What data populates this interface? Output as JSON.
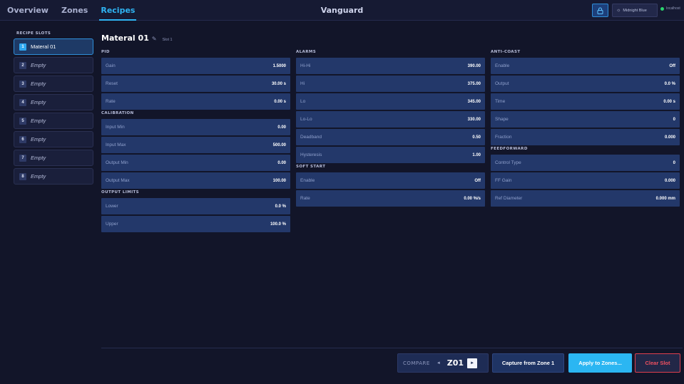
{
  "app": {
    "title": "Vanguard",
    "nav": [
      "Overview",
      "Zones",
      "Recipes"
    ],
    "active_nav": "Recipes",
    "theme_label": "Midnight Blue",
    "connection_label": "localhost"
  },
  "sidebar": {
    "heading": "RECIPE SLOTS",
    "slots": [
      {
        "num": "1",
        "name": "Materal 01",
        "active": true
      },
      {
        "num": "2",
        "name": "Empty"
      },
      {
        "num": "3",
        "name": "Empty"
      },
      {
        "num": "4",
        "name": "Empty"
      },
      {
        "num": "5",
        "name": "Empty"
      },
      {
        "num": "6",
        "name": "Empty"
      },
      {
        "num": "7",
        "name": "Empty"
      },
      {
        "num": "8",
        "name": "Empty"
      }
    ]
  },
  "recipe": {
    "name": "Materal 01",
    "slot_tag": "Slot 1"
  },
  "sections": {
    "pid": {
      "title": "PID",
      "rows": [
        {
          "label": "Gain",
          "value": "1.5000"
        },
        {
          "label": "Reset",
          "value": "30.00 s"
        },
        {
          "label": "Rate",
          "value": "0.00 s"
        }
      ]
    },
    "calibration": {
      "title": "CALIBRATION",
      "rows": [
        {
          "label": "Input Min",
          "value": "0.00"
        },
        {
          "label": "Input Max",
          "value": "500.00"
        },
        {
          "label": "Output Min",
          "value": "0.00"
        },
        {
          "label": "Output Max",
          "value": "100.00"
        }
      ]
    },
    "output_limits": {
      "title": "OUTPUT LIMITS",
      "rows": [
        {
          "label": "Lower",
          "value": "0.0 %"
        },
        {
          "label": "Upper",
          "value": "100.0 %"
        }
      ]
    },
    "alarms": {
      "title": "ALARMS",
      "rows": [
        {
          "label": "Hi-Hi",
          "value": "390.00"
        },
        {
          "label": "Hi",
          "value": "375.00"
        },
        {
          "label": "Lo",
          "value": "345.00"
        },
        {
          "label": "Lo-Lo",
          "value": "330.00"
        },
        {
          "label": "Deadband",
          "value": "0.50"
        },
        {
          "label": "Hysteresis",
          "value": "1.00"
        }
      ]
    },
    "soft_start": {
      "title": "SOFT START",
      "rows": [
        {
          "label": "Enable",
          "value": "Off"
        },
        {
          "label": "Rate",
          "value": "0.00 %/s"
        }
      ]
    },
    "anti_coast": {
      "title": "ANTI-COAST",
      "rows": [
        {
          "label": "Enable",
          "value": "Off"
        },
        {
          "label": "Output",
          "value": "0.0 %"
        },
        {
          "label": "Time",
          "value": "0.00 s"
        },
        {
          "label": "Shape",
          "value": "0"
        },
        {
          "label": "Fraction",
          "value": "0.000"
        }
      ]
    },
    "feedforward": {
      "title": "FEEDFORWARD",
      "rows": [
        {
          "label": "Control Type",
          "value": "0"
        },
        {
          "label": "FF Gain",
          "value": "0.000"
        },
        {
          "label": "Ref Diameter",
          "value": "0.000 mm"
        }
      ]
    }
  },
  "footer": {
    "compare_label": "COMPARE",
    "zone": "Z01",
    "capture_label": "Capture from Zone 1",
    "apply_label": "Apply to Zones...",
    "clear_label": "Clear Slot"
  },
  "colors": {
    "background": "#121529",
    "accent": "#2fb4f3",
    "field": "#23386a",
    "danger": "#e0404f"
  }
}
